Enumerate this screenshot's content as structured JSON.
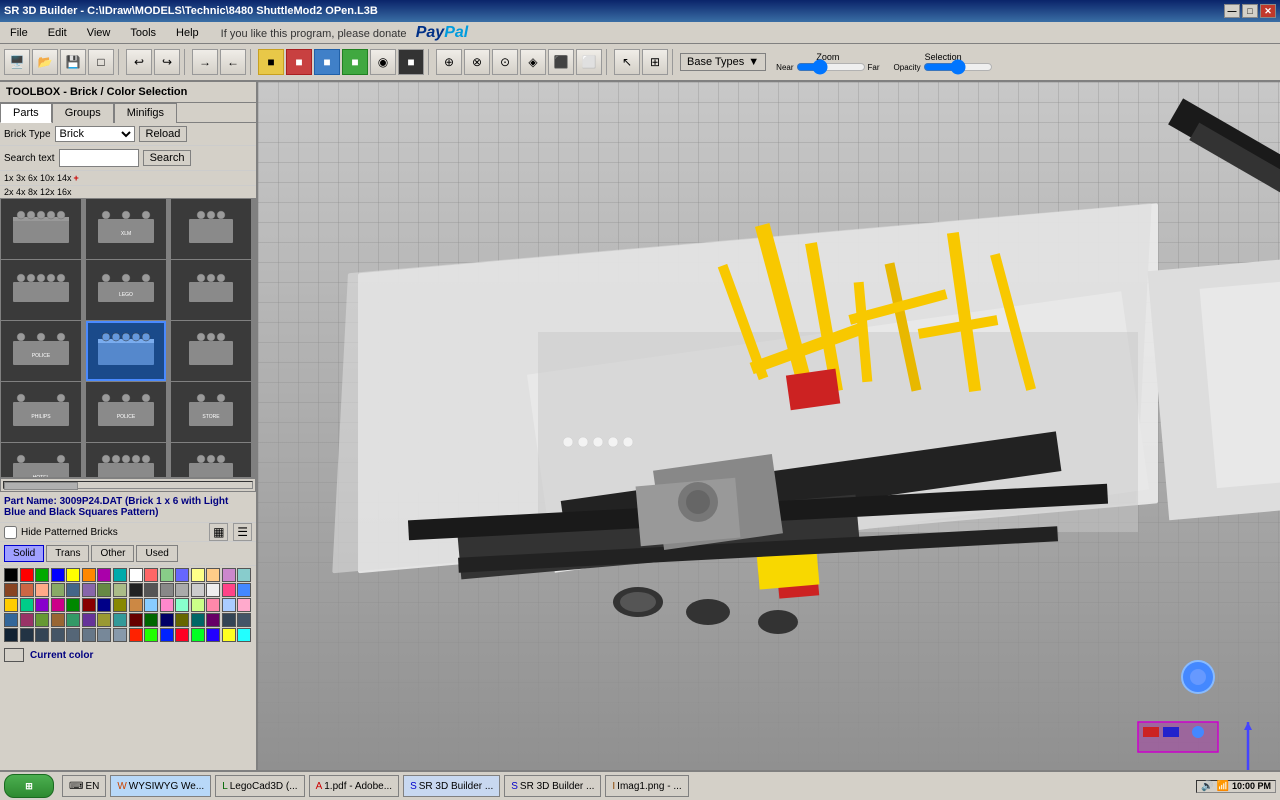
{
  "titlebar": {
    "title": "SR 3D Builder - C:\\IDraw\\MODELS\\Technic\\8480 ShuttleMod2 OPen.L3B",
    "minimize": "—",
    "maximize": "□",
    "close": "✕"
  },
  "menu": {
    "items": [
      "File",
      "Edit",
      "View",
      "Tools",
      "Help"
    ]
  },
  "toolbar": {
    "base_types_label": "Base Types",
    "zoom_label": "Zoom",
    "zoom_near": "Near",
    "zoom_far": "Far",
    "selection_label": "Selection",
    "opacity_label": "Opacity"
  },
  "toolbox": {
    "title": "TOOLBOX - Brick / Color Selection",
    "tabs": [
      "Parts",
      "Groups",
      "Minifigs"
    ],
    "brick_type_label": "Brick Type",
    "brick_type_value": "Brick",
    "reload_btn": "Reload",
    "search_label": "Search text",
    "search_btn": "Search",
    "sizes": [
      "1x",
      "2x",
      "3x",
      "4x",
      "6x",
      "8x",
      "10x",
      "12x",
      "14x",
      "16x",
      "+"
    ],
    "part_name": "Part Name: 3009P24.DAT (Brick 1 x 6 with Light Blue and Black Squares Pattern)",
    "hide_patterned": "Hide Patterned Bricks",
    "filter_btns": [
      "Solid",
      "Trans",
      "Other",
      "Used"
    ],
    "current_color_label": "Current color"
  },
  "colors": [
    "#000000",
    "#ff0000",
    "#00aa00",
    "#0000ff",
    "#ffff00",
    "#ff8800",
    "#aa00aa",
    "#00aaaa",
    "#ffffff",
    "#ff6666",
    "#88cc88",
    "#6666ff",
    "#ffff88",
    "#ffcc88",
    "#cc88cc",
    "#88cccc",
    "#884422",
    "#cc6644",
    "#ffaa88",
    "#88aa66",
    "#446688",
    "#8866aa",
    "#668844",
    "#aabb88",
    "#222222",
    "#555555",
    "#888888",
    "#aaaaaa",
    "#cccccc",
    "#eeeeee",
    "#ff4488",
    "#4488ff",
    "#ffcc00",
    "#00cc88",
    "#8800cc",
    "#cc0088",
    "#008800",
    "#880000",
    "#000088",
    "#888800",
    "#cc8844",
    "#88ccff",
    "#ff88cc",
    "#88ffcc",
    "#ccff88",
    "#ff88aa",
    "#aaccff",
    "#ffaacc",
    "#336699",
    "#993366",
    "#669933",
    "#996633",
    "#339966",
    "#663399",
    "#999933",
    "#339999",
    "#660000",
    "#006600",
    "#000066",
    "#666600",
    "#006666",
    "#660066",
    "#334455",
    "#445566",
    "#112233",
    "#223344",
    "#334455",
    "#445566",
    "#556677",
    "#667788",
    "#778899",
    "#8899aa",
    "#ff2200",
    "#22ff00",
    "#0022ff",
    "#ff0022",
    "#00ff22",
    "#2200ff",
    "#ffff22",
    "#22ffff"
  ],
  "statusbar": {
    "taskbar_items": [
      {
        "label": "WYSIWYG We...",
        "icon": "W"
      },
      {
        "label": "LegoCad3D (...",
        "icon": "L"
      },
      {
        "label": "1.pdf - Adobe...",
        "icon": "A"
      },
      {
        "label": "SR 3D Builder ...",
        "icon": "S"
      },
      {
        "label": "SR 3D Builder ...",
        "icon": "S"
      },
      {
        "label": "Imag1.png - ...",
        "icon": "I"
      }
    ],
    "time": "10:00 PM",
    "lang": "EN"
  }
}
